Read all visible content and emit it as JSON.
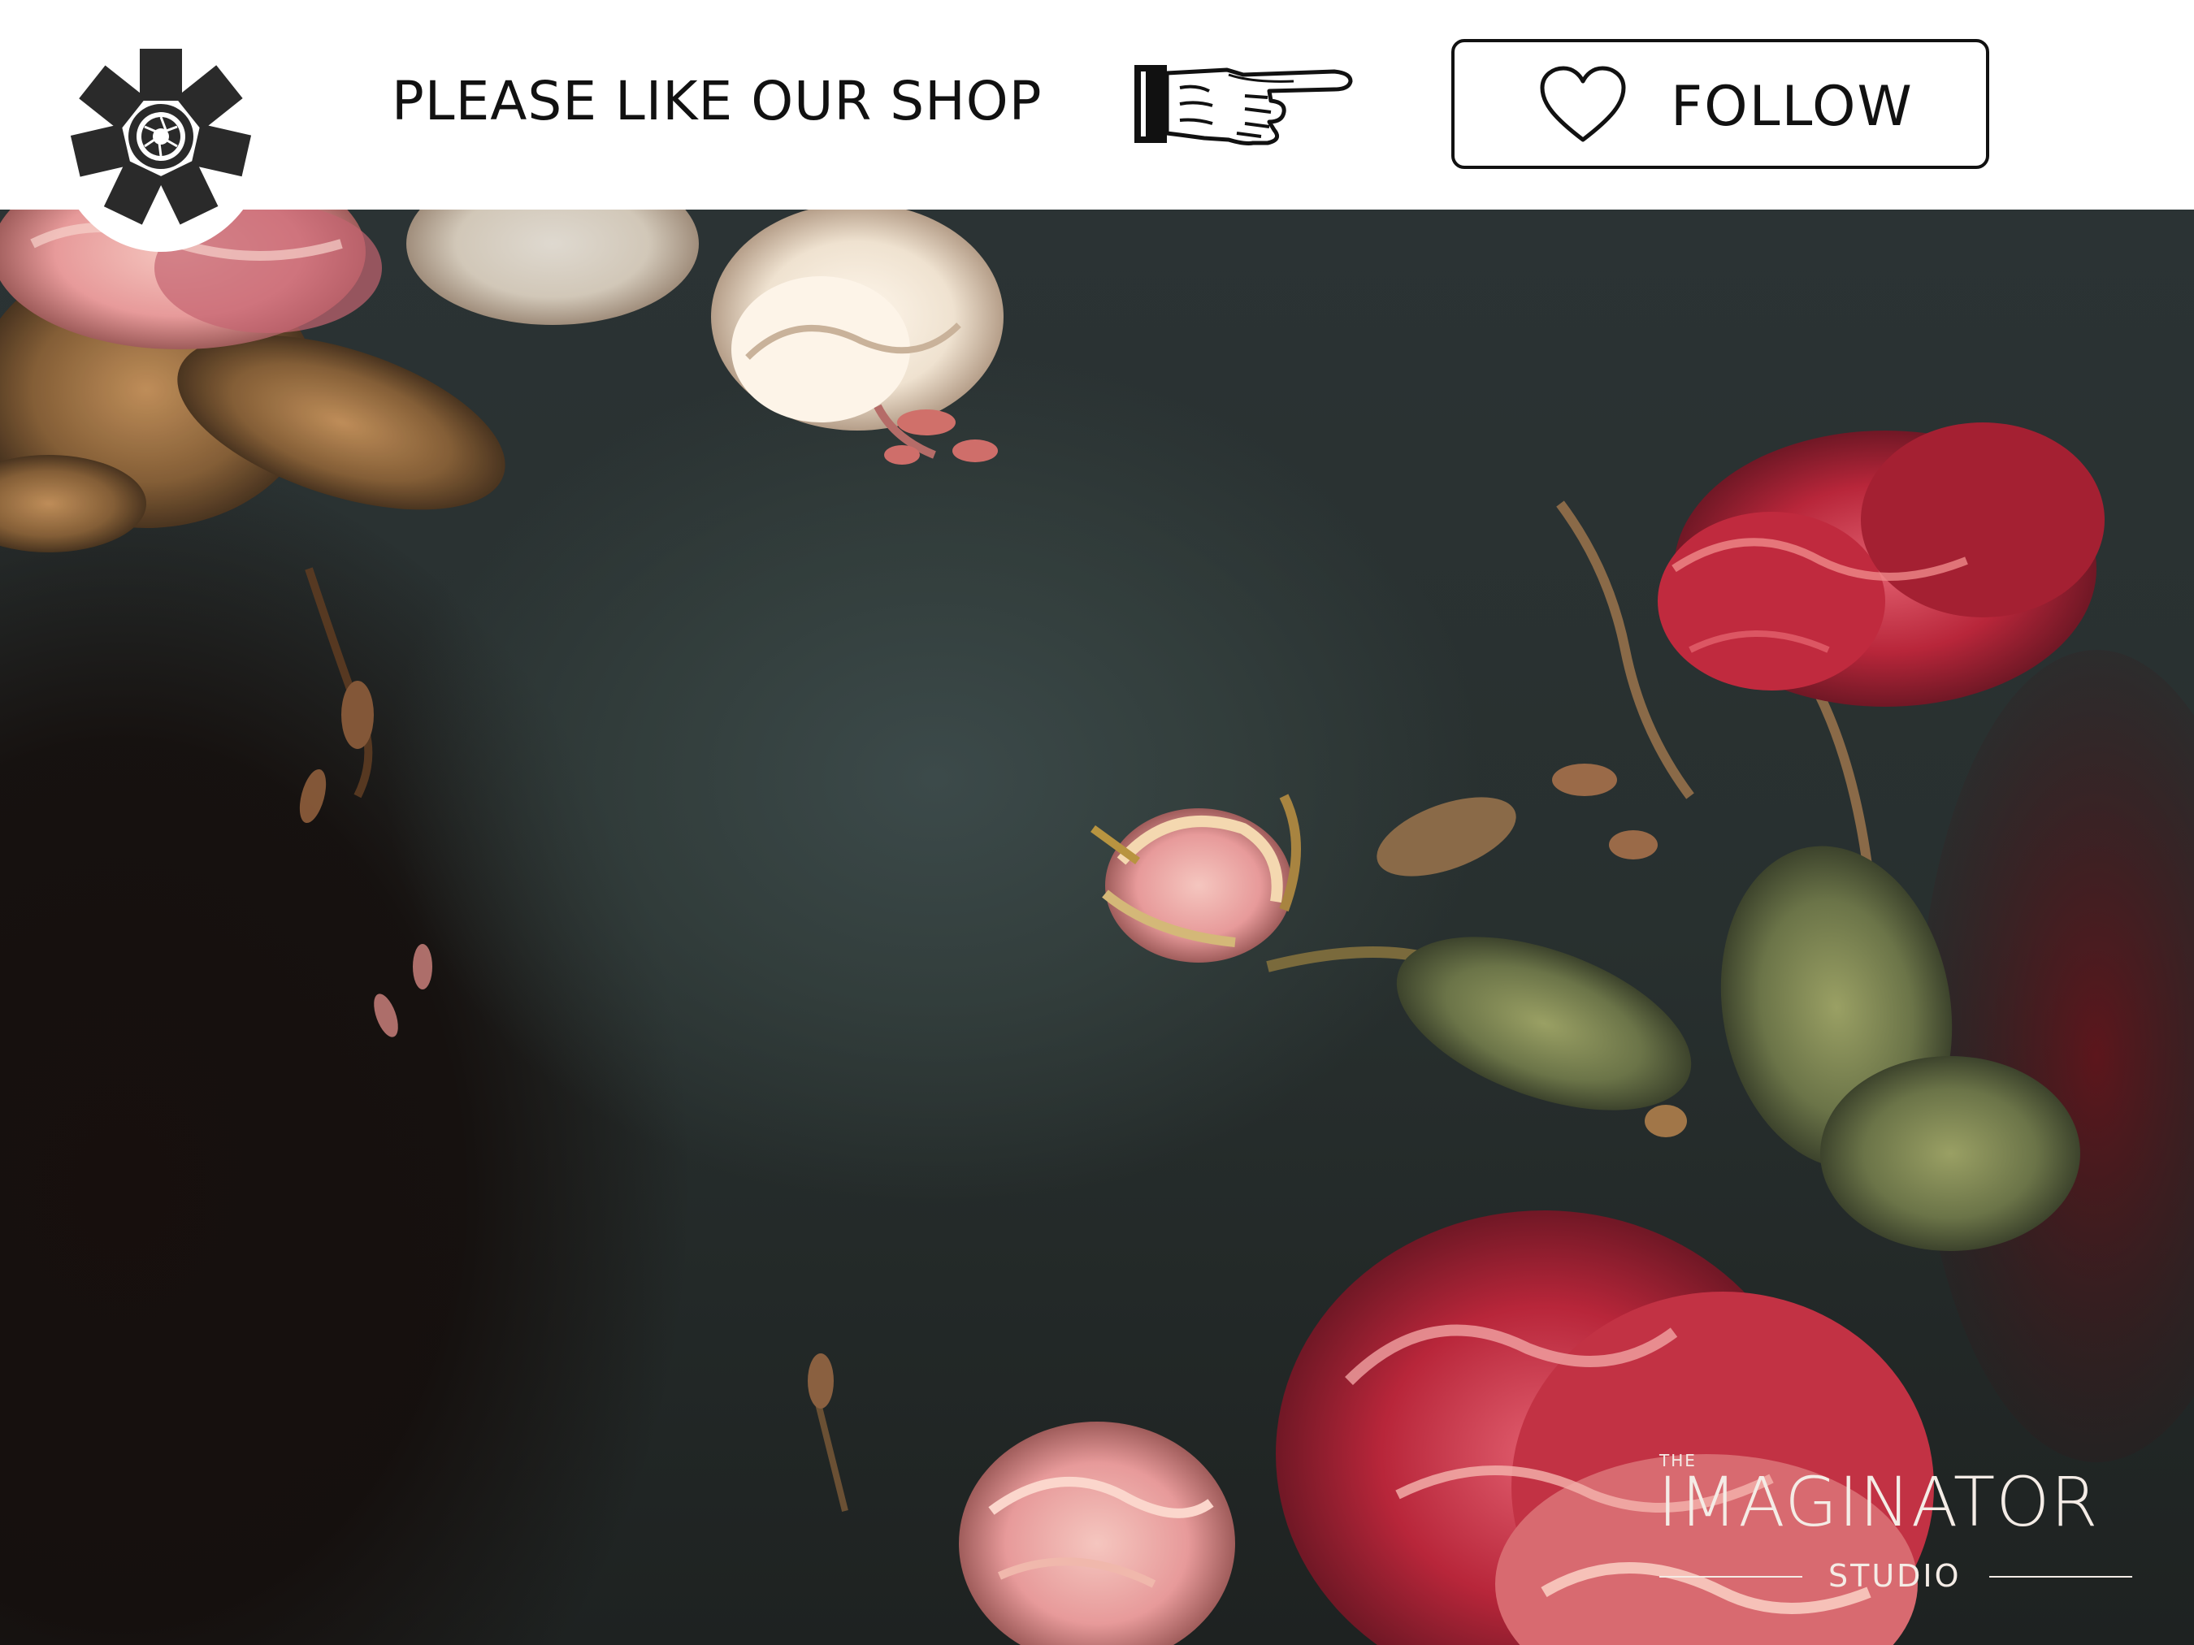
{
  "header": {
    "headline": "PLEASE LIKE OUR SHOP",
    "follow_label": "FOLLOW"
  },
  "icons": {
    "logo": "camera-aperture-flower-logo",
    "hand": "pointing-hand-icon",
    "heart": "heart-outline-icon"
  },
  "watermark": {
    "prefix": "THE",
    "name": "IMAGINATOR",
    "suffix": "STUDIO"
  },
  "colors": {
    "header_bg": "#ffffff",
    "text": "#111111",
    "painting_bg": "#2b3334",
    "rose_red": "#b8263a",
    "blush_pink": "#e79a9a",
    "cream": "#efe2d0"
  }
}
